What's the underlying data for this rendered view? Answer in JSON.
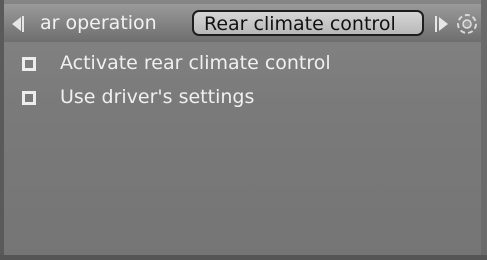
{
  "tabs": {
    "previous_label": "ar operation",
    "active_label": "Rear climate control",
    "prev_arrow_icon": "triangle-left-icon",
    "next_arrow_icon": "triangle-right-icon",
    "controller_icon": "controller-rotate-icon"
  },
  "menu": {
    "items": [
      {
        "label": "Activate rear climate control",
        "checked": false
      },
      {
        "label": "Use driver's settings",
        "checked": false
      }
    ]
  },
  "colors": {
    "background": "#7d7d7d",
    "active_tab": "#c8c8c8",
    "text": "#f0f0f0"
  }
}
